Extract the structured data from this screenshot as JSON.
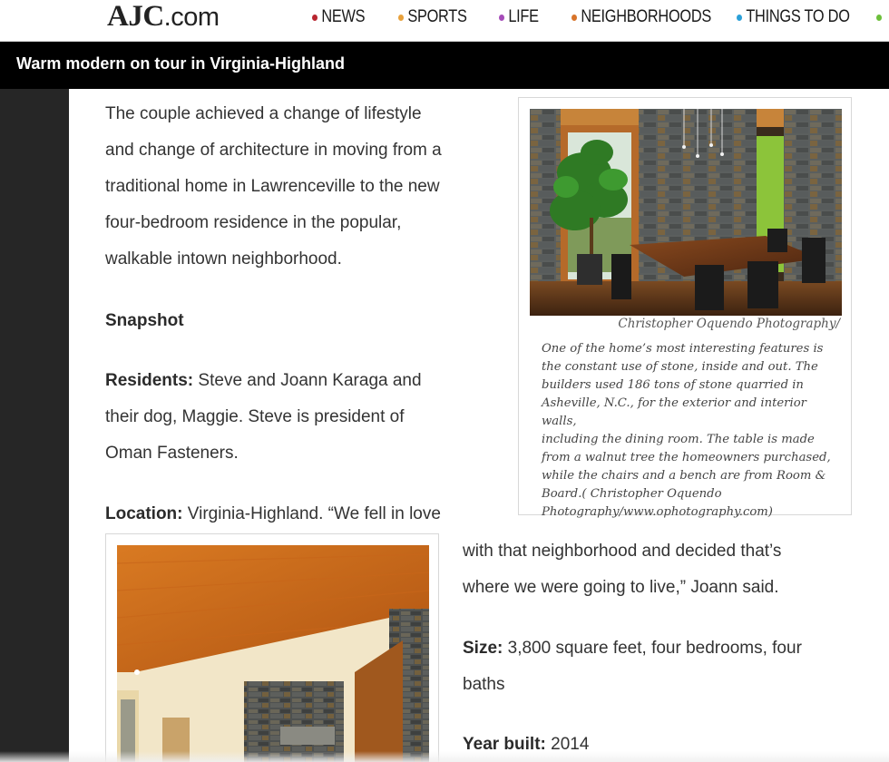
{
  "site": {
    "logo_bold": "AJC",
    "logo_rest": ".com"
  },
  "nav": {
    "items": [
      {
        "label": "NEWS",
        "color": "#b8252f"
      },
      {
        "label": "SPORTS",
        "color": "#e8a13b"
      },
      {
        "label": "LIFE",
        "color": "#a54bb8"
      },
      {
        "label": "NEIGHBORHOODS",
        "color": "#d8742a"
      },
      {
        "label": "THINGS TO DO",
        "color": "#2aa0d8"
      }
    ],
    "extra_bullet_color": "#6cbf3a"
  },
  "article": {
    "title": "Warm modern on tour in Virginia-Highland",
    "intro_lines": [
      "The couple achieved a change of lifestyle",
      "and change of architecture in moving from a",
      "traditional home in Lawrenceville to the new",
      "four-bedroom residence in the popular,",
      "walkable intown neighborhood."
    ],
    "snapshot_heading": "Snapshot",
    "residents_label": "Residents:",
    "residents_line1": " Steve and Joann Karaga and",
    "residents_line2": "their dog, Maggie. Steve is president of",
    "residents_line3": "Oman Fasteners.",
    "location_label": "Location:",
    "location_line1": " Virginia-Highland. “We fell in love",
    "location_line2": "with that neighborhood and decided that’s",
    "location_line3": "where we were going to live,” Joann said.",
    "size_label": "Size:",
    "size_line1": " 3,800 square feet, four bedrooms, four",
    "size_line2": "baths",
    "year_label": "Year built:",
    "year_value": " 2014"
  },
  "figure1": {
    "credit": "Christopher Oquendo Photography/",
    "caption_lines": [
      "One of the home’s most interesting features is",
      "the constant use of stone, inside and out. The",
      "builders used 186 tons of stone quarried in",
      "Asheville, N.C., for the exterior and interior walls,",
      "including the dining room. The table is made",
      "from a walnut tree the homeowners purchased,",
      "while the chairs and a bench are from Room &",
      "Board.( Christopher Oquendo",
      "Photography/www.ophotography.com)"
    ]
  }
}
